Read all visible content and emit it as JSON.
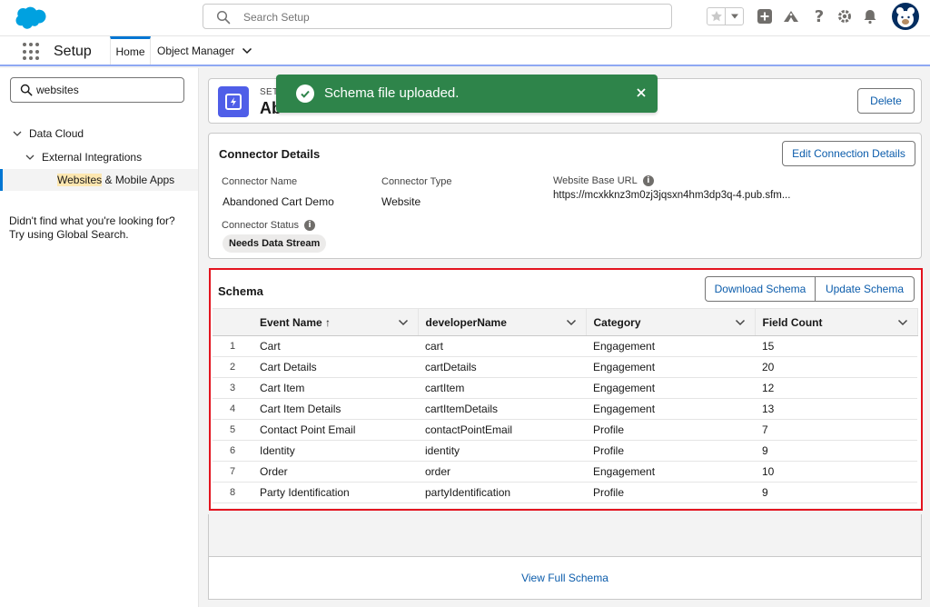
{
  "global_header": {
    "search_placeholder": "Search Setup",
    "icons": [
      "favorites-star-icon",
      "favorites-dropdown-icon",
      "add-icon",
      "trailhead-icon",
      "help-icon",
      "settings-gear-icon",
      "notifications-bell-icon",
      "user-avatar-icon"
    ]
  },
  "context_bar": {
    "app_name": "Setup",
    "tabs": [
      {
        "label": "Home",
        "active": true
      },
      {
        "label": "Object Manager",
        "has_dropdown": true
      }
    ]
  },
  "sidebar": {
    "search_value": "websites",
    "tree": [
      {
        "label": "Data Cloud",
        "expanded": true,
        "level": 1
      },
      {
        "label": "External Integrations",
        "expanded": true,
        "level": 2
      },
      {
        "label_highlight": "Websites",
        "label_rest": " & Mobile Apps",
        "level": 3,
        "selected": true
      }
    ],
    "help_text": "Didn't find what you're looking for? Try using Global Search."
  },
  "record_header": {
    "eyebrow": "SET",
    "title": "Ab",
    "delete_label": "Delete"
  },
  "toast": {
    "message": "Schema file uploaded.",
    "variant": "success",
    "color": "#2e844a"
  },
  "connector_details": {
    "title": "Connector Details",
    "edit_label": "Edit Connection Details",
    "fields": {
      "name_label": "Connector Name",
      "name_value": "Abandoned Cart Demo",
      "type_label": "Connector Type",
      "type_value": "Website",
      "url_label": "Website Base URL",
      "url_value": "https://mcxkknz3m0zj3jqsxn4hm3dp3q-4.pub.sfm...",
      "status_label": "Connector Status",
      "status_value": "Needs Data Stream"
    }
  },
  "schema": {
    "title": "Schema",
    "download_label": "Download Schema",
    "update_label": "Update Schema",
    "columns": [
      "Event Name ↑",
      "developerName",
      "Category",
      "Field Count"
    ],
    "rows": [
      {
        "num": "1",
        "event": "Cart",
        "dev": "cart",
        "category": "Engagement",
        "count": "15"
      },
      {
        "num": "2",
        "event": "Cart Details",
        "dev": "cartDetails",
        "category": "Engagement",
        "count": "20"
      },
      {
        "num": "3",
        "event": "Cart Item",
        "dev": "cartItem",
        "category": "Engagement",
        "count": "12"
      },
      {
        "num": "4",
        "event": "Cart Item Details",
        "dev": "cartItemDetails",
        "category": "Engagement",
        "count": "13"
      },
      {
        "num": "5",
        "event": "Contact Point Email",
        "dev": "contactPointEmail",
        "category": "Profile",
        "count": "7"
      },
      {
        "num": "6",
        "event": "Identity",
        "dev": "identity",
        "category": "Profile",
        "count": "9"
      },
      {
        "num": "7",
        "event": "Order",
        "dev": "order",
        "category": "Engagement",
        "count": "10"
      },
      {
        "num": "8",
        "event": "Party Identification",
        "dev": "partyIdentification",
        "category": "Profile",
        "count": "9"
      }
    ],
    "view_full_label": "View Full Schema",
    "highlight_color": "#e3141f"
  },
  "colors": {
    "brand": "#0176d3",
    "link": "#0b5cab",
    "success": "#2e844a",
    "icon_tile": "#4f5ee8"
  }
}
